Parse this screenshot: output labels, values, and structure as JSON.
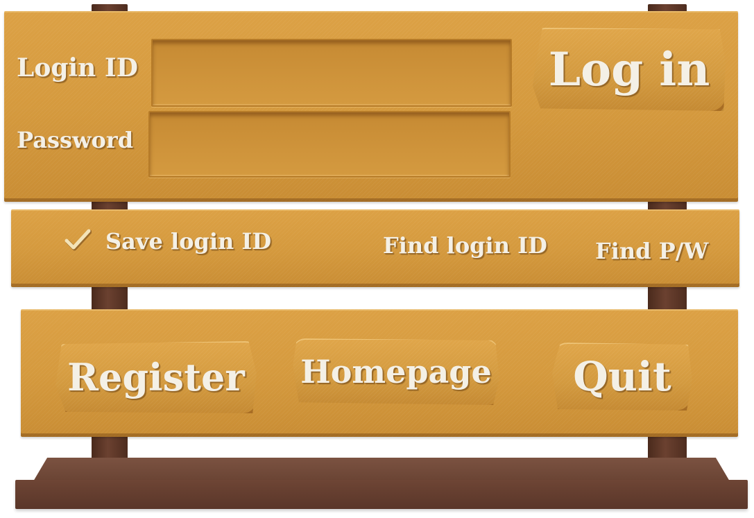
{
  "login": {
    "login_id_label": "Login ID",
    "password_label": "Password",
    "login_id_value": "",
    "password_value": "",
    "login_button_label": "Log in"
  },
  "options": {
    "save_login_id_label": "Save login ID",
    "save_login_id_checked": true,
    "find_login_id_label": "Find login ID",
    "find_pw_label": "Find P/W"
  },
  "actions": {
    "register_label": "Register",
    "homepage_label": "Homepage",
    "quit_label": "Quit"
  },
  "icons": {
    "checkmark": "check-icon"
  },
  "colors": {
    "board": "#d59a3e",
    "post": "#5a3528",
    "text": "#f4f0e6"
  }
}
